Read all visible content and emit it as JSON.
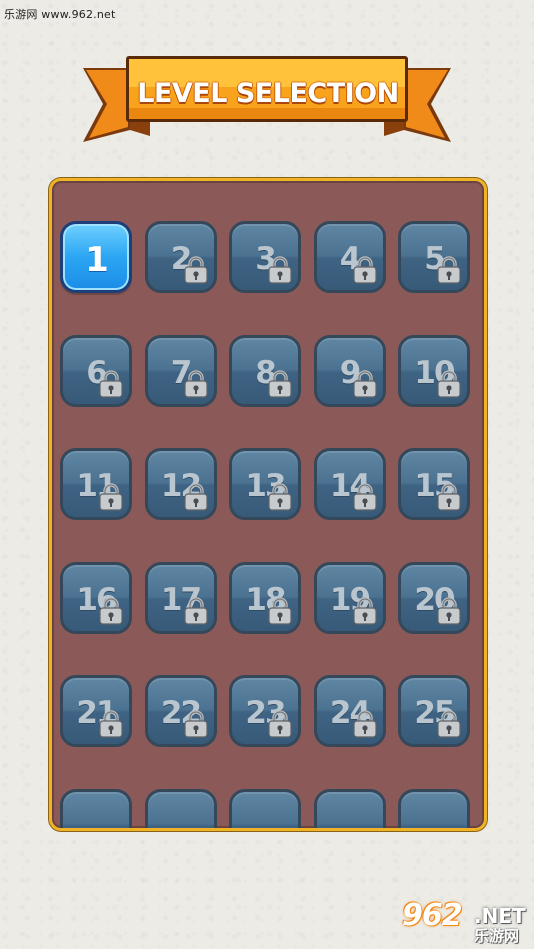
{
  "watermark": {
    "top_text": "乐游网 www.962.net",
    "logo_number": "962",
    "logo_net": ".NET",
    "logo_cn": "乐游网"
  },
  "header": {
    "title": "LEVEL SELECTION"
  },
  "colors": {
    "ribbon": "#f7a21c",
    "board": "#8b5a58",
    "board_border": "#f0b325",
    "tile_locked": "#4c7291",
    "tile_unlocked": "#2ba6f3"
  },
  "levels": [
    {
      "label": "1",
      "locked": false
    },
    {
      "label": "2",
      "locked": true
    },
    {
      "label": "3",
      "locked": true
    },
    {
      "label": "4",
      "locked": true
    },
    {
      "label": "5",
      "locked": true
    },
    {
      "label": "6",
      "locked": true
    },
    {
      "label": "7",
      "locked": true
    },
    {
      "label": "8",
      "locked": true
    },
    {
      "label": "9",
      "locked": true
    },
    {
      "label": "10",
      "locked": true
    },
    {
      "label": "11",
      "locked": true
    },
    {
      "label": "12",
      "locked": true
    },
    {
      "label": "13",
      "locked": true
    },
    {
      "label": "14",
      "locked": true
    },
    {
      "label": "15",
      "locked": true
    },
    {
      "label": "16",
      "locked": true
    },
    {
      "label": "17",
      "locked": true
    },
    {
      "label": "18",
      "locked": true
    },
    {
      "label": "19",
      "locked": true
    },
    {
      "label": "20",
      "locked": true
    },
    {
      "label": "21",
      "locked": true
    },
    {
      "label": "22",
      "locked": true
    },
    {
      "label": "23",
      "locked": true
    },
    {
      "label": "24",
      "locked": true
    },
    {
      "label": "25",
      "locked": true
    },
    {
      "label": "",
      "locked": true
    },
    {
      "label": "",
      "locked": true
    },
    {
      "label": "",
      "locked": true
    },
    {
      "label": "",
      "locked": true
    },
    {
      "label": "",
      "locked": true
    }
  ],
  "icons": {
    "lock": "padlock-icon"
  }
}
